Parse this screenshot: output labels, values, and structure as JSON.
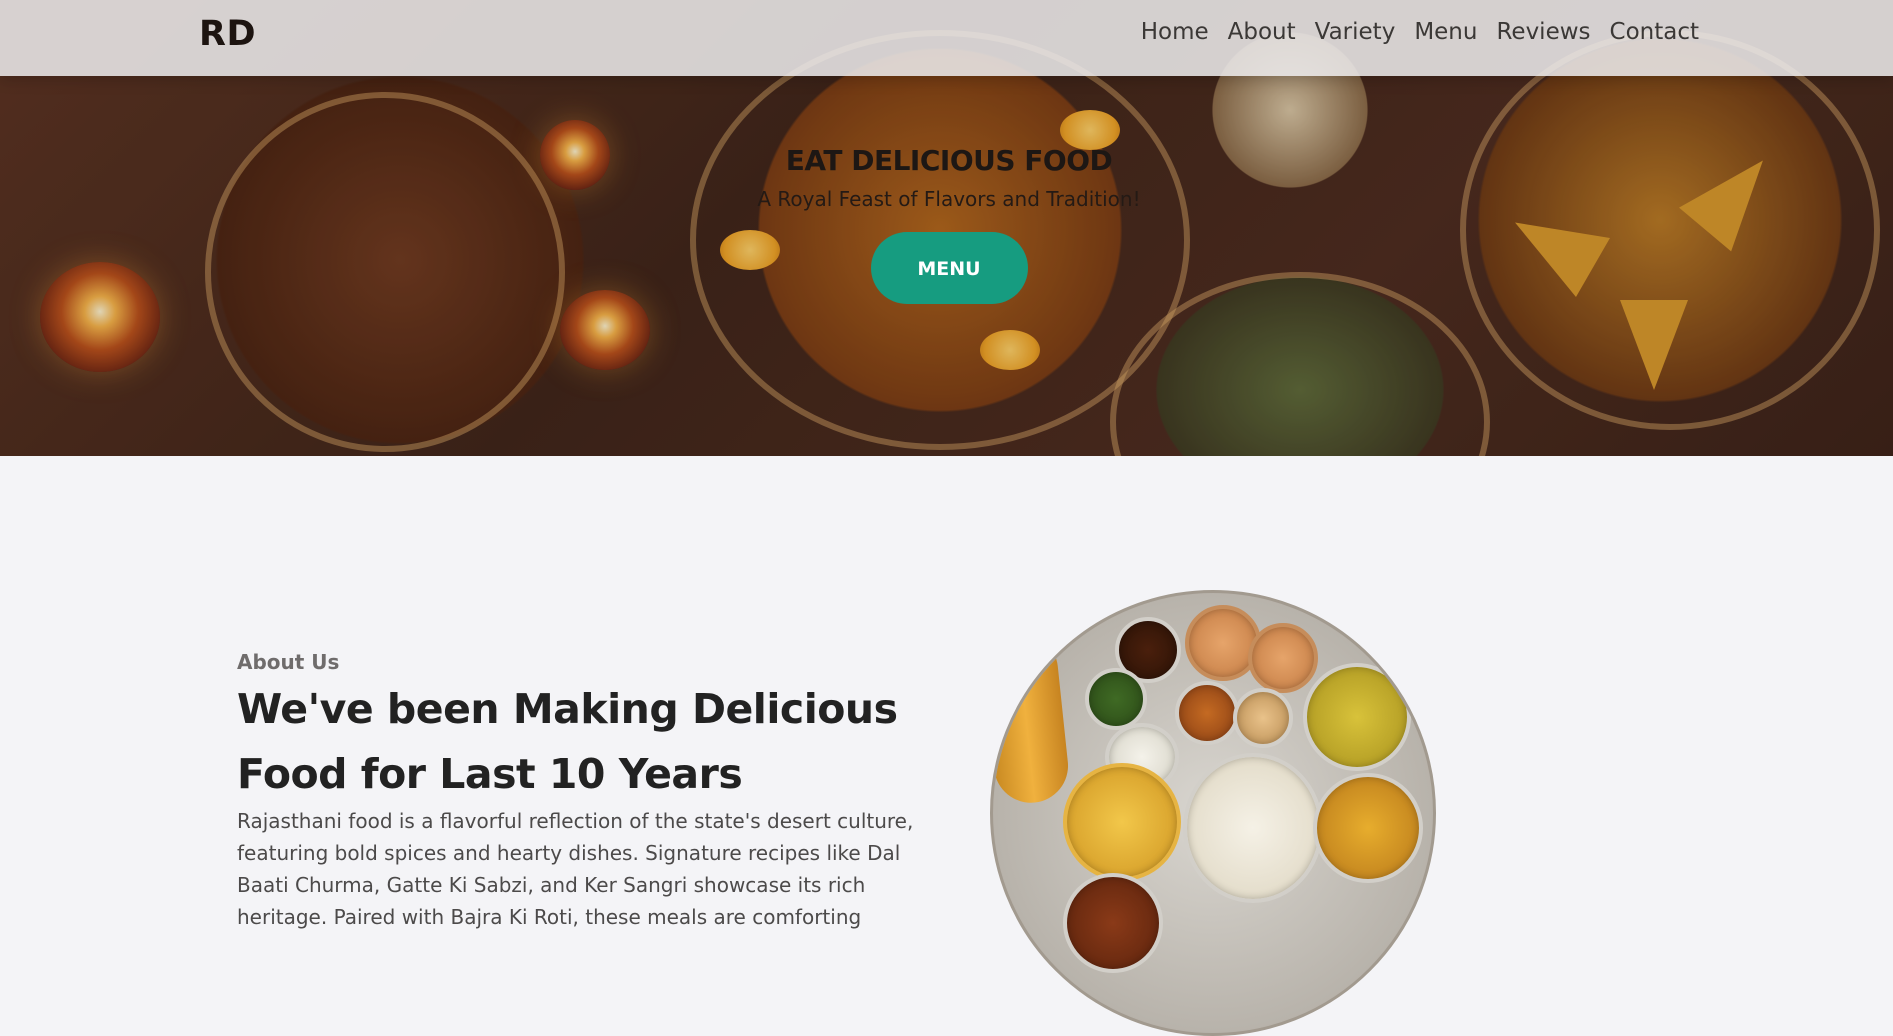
{
  "navbar": {
    "logo": "RD",
    "links": [
      "Home",
      "About",
      "Variety",
      "Menu",
      "Reviews",
      "Contact"
    ]
  },
  "hero": {
    "title": "EAT DELICIOUS FOOD",
    "subtitle": "A Royal Feast of Flavors and Tradition!",
    "button_label": "MENU"
  },
  "about": {
    "label": "About Us",
    "heading": "We've been Making Delicious Food for Last 10 Years",
    "text": "Rajasthani food is a flavorful reflection of the state's desert culture, featuring bold spices and hearty dishes. Signature recipes like Dal Baati Churma, Gatte Ki Sabzi, and Ker Sangri showcase its rich heritage. Paired with Bajra Ki Roti, these meals are comforting"
  },
  "colors": {
    "accent": "#169c80",
    "navbar_bg": "#eeeced",
    "page_bg": "#f4f4f7"
  }
}
